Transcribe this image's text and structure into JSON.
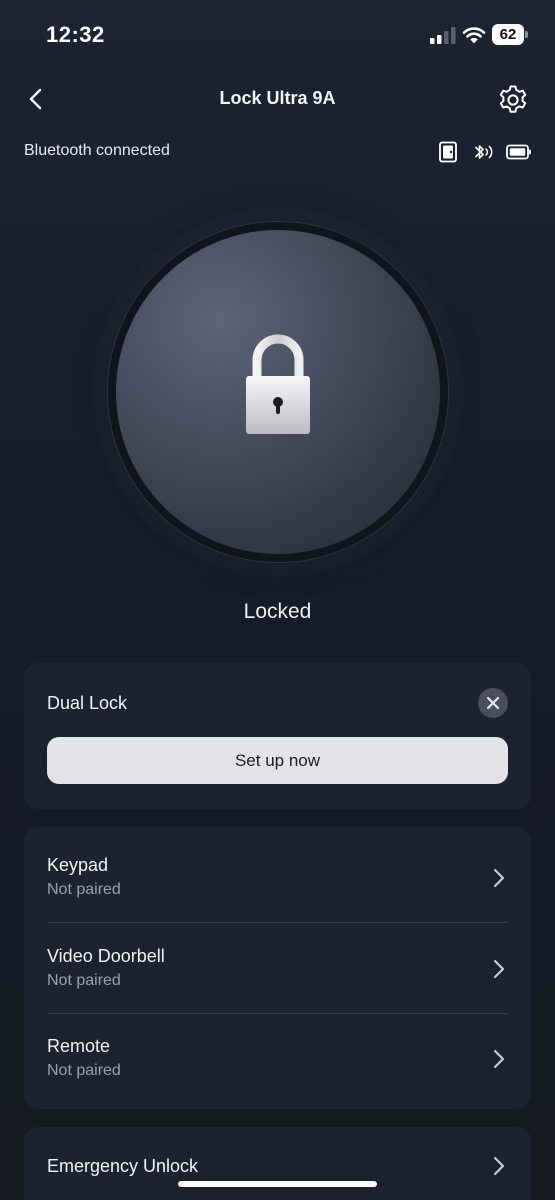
{
  "status_bar": {
    "time": "12:32",
    "battery_level": "62"
  },
  "nav": {
    "title": "Lock Ultra 9A"
  },
  "connection": {
    "text": "Bluetooth connected"
  },
  "lock": {
    "state": "Locked"
  },
  "dual_lock": {
    "title": "Dual Lock",
    "button_label": "Set up now"
  },
  "devices": [
    {
      "name": "Keypad",
      "status": "Not paired"
    },
    {
      "name": "Video Doorbell",
      "status": "Not paired"
    },
    {
      "name": "Remote",
      "status": "Not paired"
    }
  ],
  "emergency": {
    "label": "Emergency Unlock"
  },
  "icons": {
    "back": "chevron-left-icon",
    "settings": "gear-icon",
    "door": "door-icon",
    "bluetooth": "bluetooth-icon",
    "battery": "battery-icon",
    "lock": "padlock-icon",
    "close": "close-icon",
    "row": "chevron-right-icon"
  },
  "colors": {
    "background": "#151b27",
    "card": "#1d2230",
    "button": "#e3e4e8",
    "secondary_text": "#9aa1ad"
  }
}
